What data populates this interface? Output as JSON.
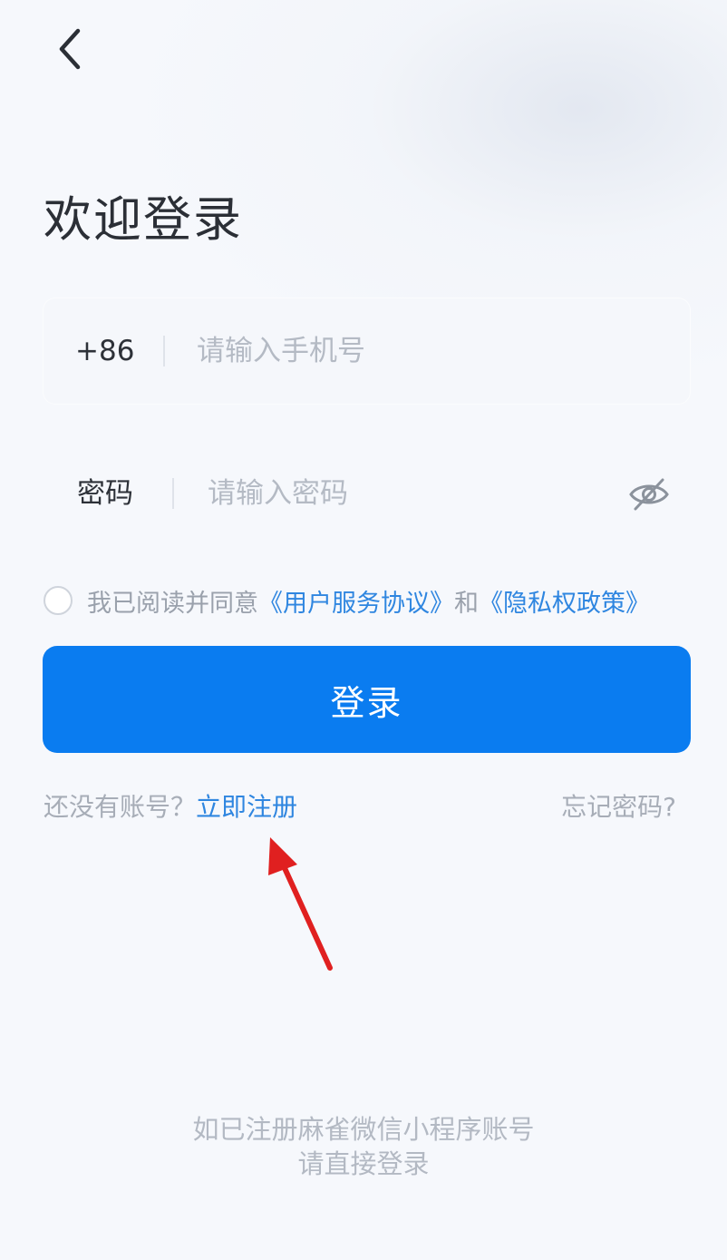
{
  "header": {
    "back_icon": "chevron-left-icon",
    "title": "欢迎登录"
  },
  "phone_field": {
    "prefix": "+86",
    "placeholder": "请输入手机号",
    "value": ""
  },
  "password_field": {
    "label": "密码",
    "placeholder": "请输入密码",
    "value": "",
    "toggle_icon": "eye-off-icon"
  },
  "agreement": {
    "prefix_text": "我已阅读并同意",
    "terms_link": "《用户服务协议》",
    "conjunction": "和",
    "privacy_link": "《隐私权政策》",
    "checked": false
  },
  "login_button": "登录",
  "links": {
    "no_account": "还没有账号？",
    "register": "立即注册",
    "forgot_password": "忘记密码?"
  },
  "annotation": {
    "arrow_icon": "red-arrow-icon",
    "color": "#e02020"
  },
  "footer": {
    "line1": "如已注册麻雀微信小程序账号",
    "line2": "请直接登录"
  },
  "colors": {
    "primary": "#0a7cf0",
    "link": "#2f86e0"
  }
}
